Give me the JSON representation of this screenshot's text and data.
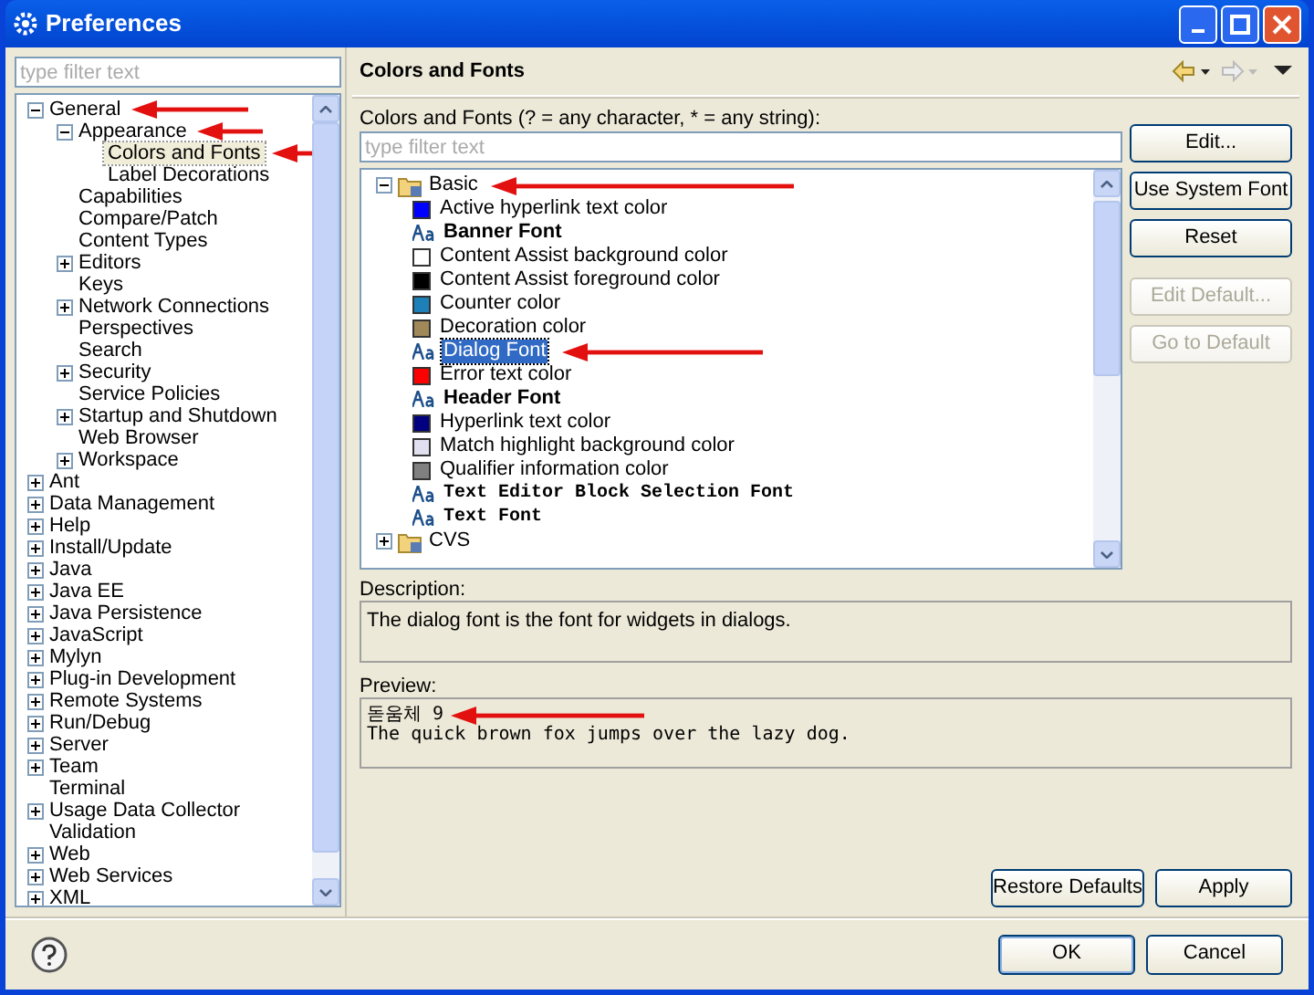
{
  "window": {
    "title": "Preferences"
  },
  "filter": {
    "placeholder": "type filter text"
  },
  "nav_tree": [
    {
      "label": "General",
      "expanded": true,
      "selected": false,
      "arrow": true,
      "children": [
        {
          "label": "Appearance",
          "expanded": true,
          "selected": false,
          "arrow": true,
          "children": [
            {
              "label": "Colors and Fonts",
              "selected": true,
              "arrow": true
            },
            {
              "label": "Label Decorations",
              "selected": false
            }
          ]
        },
        {
          "label": "Capabilities",
          "selected": false
        },
        {
          "label": "Compare/Patch",
          "selected": false
        },
        {
          "label": "Content Types",
          "selected": false
        },
        {
          "label": "Editors",
          "expanded": false,
          "selected": false
        },
        {
          "label": "Keys",
          "selected": false
        },
        {
          "label": "Network Connections",
          "expanded": false,
          "selected": false
        },
        {
          "label": "Perspectives",
          "selected": false
        },
        {
          "label": "Search",
          "selected": false
        },
        {
          "label": "Security",
          "expanded": false,
          "selected": false
        },
        {
          "label": "Service Policies",
          "selected": false
        },
        {
          "label": "Startup and Shutdown",
          "expanded": false,
          "selected": false
        },
        {
          "label": "Web Browser",
          "selected": false
        },
        {
          "label": "Workspace",
          "expanded": false,
          "selected": false
        }
      ]
    },
    {
      "label": "Ant",
      "expanded": false,
      "selected": false
    },
    {
      "label": "Data Management",
      "expanded": false,
      "selected": false
    },
    {
      "label": "Help",
      "expanded": false,
      "selected": false
    },
    {
      "label": "Install/Update",
      "expanded": false,
      "selected": false
    },
    {
      "label": "Java",
      "expanded": false,
      "selected": false
    },
    {
      "label": "Java EE",
      "expanded": false,
      "selected": false
    },
    {
      "label": "Java Persistence",
      "expanded": false,
      "selected": false
    },
    {
      "label": "JavaScript",
      "expanded": false,
      "selected": false
    },
    {
      "label": "Mylyn",
      "expanded": false,
      "selected": false
    },
    {
      "label": "Plug-in Development",
      "expanded": false,
      "selected": false
    },
    {
      "label": "Remote Systems",
      "expanded": false,
      "selected": false
    },
    {
      "label": "Run/Debug",
      "expanded": false,
      "selected": false
    },
    {
      "label": "Server",
      "expanded": false,
      "selected": false
    },
    {
      "label": "Team",
      "expanded": false,
      "selected": false
    },
    {
      "label": "Terminal",
      "selected": false
    },
    {
      "label": "Usage Data Collector",
      "expanded": false,
      "selected": false
    },
    {
      "label": "Validation",
      "selected": false
    },
    {
      "label": "Web",
      "expanded": false,
      "selected": false
    },
    {
      "label": "Web Services",
      "expanded": false,
      "selected": false
    },
    {
      "label": "XML",
      "expanded": false,
      "selected": false
    }
  ],
  "page": {
    "title": "Colors and Fonts",
    "tree_label": "Colors and Fonts (? = any character, * = any string):",
    "filter": {
      "placeholder": "type filter text"
    },
    "categories": [
      {
        "label": "Basic",
        "expanded": true,
        "arrow": true,
        "items": [
          {
            "kind": "color",
            "label": "Active hyperlink text color",
            "color": "#0000ff",
            "selected": false
          },
          {
            "kind": "bold_font",
            "label": "Banner Font",
            "selected": false
          },
          {
            "kind": "color",
            "label": "Content Assist background color",
            "color": "#ffffff",
            "selected": false
          },
          {
            "kind": "color",
            "label": "Content Assist foreground color",
            "color": "#000000",
            "selected": false
          },
          {
            "kind": "color",
            "label": "Counter color",
            "color": "#1e80b8",
            "selected": false
          },
          {
            "kind": "color",
            "label": "Decoration color",
            "color": "#a08858",
            "selected": false
          },
          {
            "kind": "font",
            "label": "Dialog Font",
            "selected": true,
            "arrow": true
          },
          {
            "kind": "color",
            "label": "Error text color",
            "color": "#ff0000",
            "selected": false
          },
          {
            "kind": "bold_font",
            "label": "Header Font",
            "selected": false
          },
          {
            "kind": "color",
            "label": "Hyperlink text color",
            "color": "#000080",
            "selected": false
          },
          {
            "kind": "color",
            "label": "Match highlight background color",
            "color": "#e0e0f0",
            "selected": false
          },
          {
            "kind": "color",
            "label": "Qualifier information color",
            "color": "#808080",
            "selected": false
          },
          {
            "kind": "mono_font",
            "label": "Text Editor Block Selection Font",
            "selected": false
          },
          {
            "kind": "mono_font",
            "label": "Text Font",
            "selected": false
          }
        ]
      },
      {
        "label": "CVS",
        "expanded": false
      }
    ],
    "side_buttons": [
      {
        "label": "Edit...",
        "disabled": false
      },
      {
        "label": "Use System Font",
        "disabled": false
      },
      {
        "label": "Reset",
        "disabled": false
      },
      {
        "label": "Edit Default...",
        "disabled": true
      },
      {
        "label": "Go to Default",
        "disabled": true
      }
    ],
    "description_label": "Description:",
    "description": "The dialog font is the font for widgets in dialogs.",
    "preview_label": "Preview:",
    "preview_lines": [
      {
        "text": "돋움체 9",
        "arrow": true
      },
      {
        "text": "The quick brown fox jumps over the lazy dog."
      }
    ],
    "buttons": [
      "Restore Defaults",
      "Apply"
    ]
  },
  "footer_buttons": [
    "OK",
    "Cancel"
  ]
}
